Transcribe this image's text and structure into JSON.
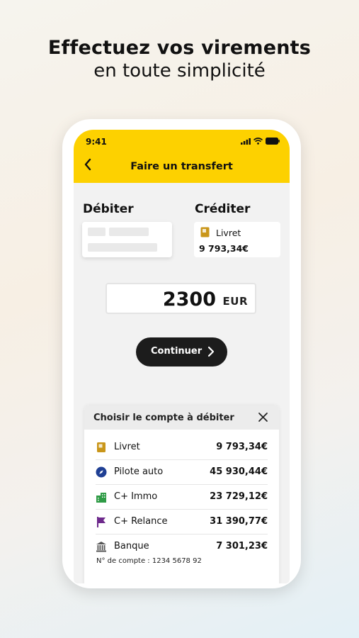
{
  "headline": {
    "line1": "Effectuez vos virements",
    "line2": "en toute simplicité"
  },
  "status_bar": {
    "time": "9:41"
  },
  "nav": {
    "back_icon": "chevron-left-icon",
    "title": "Faire un transfert"
  },
  "debit": {
    "label": "Débiter"
  },
  "credit": {
    "label": "Créditer",
    "account_name": "Livret",
    "account_amount": "9 793,34€",
    "icon": "booklet-icon"
  },
  "amount": {
    "value": "2300",
    "currency": "EUR"
  },
  "continue_button": {
    "label": "Continuer"
  },
  "sheet": {
    "title": "Choisir le compte à débiter",
    "accounts": [
      {
        "name": "Livret",
        "amount": "9 793,34€",
        "icon": "booklet-icon",
        "color": "#c9961a"
      },
      {
        "name": "Pilote auto",
        "amount": "45 930,44€",
        "icon": "compass-icon",
        "color": "#1f3f94"
      },
      {
        "name": "C+ Immo",
        "amount": "23 729,12€",
        "icon": "buildings-icon",
        "color": "#2f9b46"
      },
      {
        "name": "C+ Relance",
        "amount": "31 390,77€",
        "icon": "flag-icon",
        "color": "#6e2a8c"
      },
      {
        "name": "Banque",
        "amount": "7 301,23€",
        "icon": "bank-icon",
        "color": "#555555"
      }
    ],
    "account_number": "N° de compte : 1234 5678 92"
  },
  "colors": {
    "brand_yellow": "#fdd100",
    "button_dark": "#1c1c1c"
  }
}
